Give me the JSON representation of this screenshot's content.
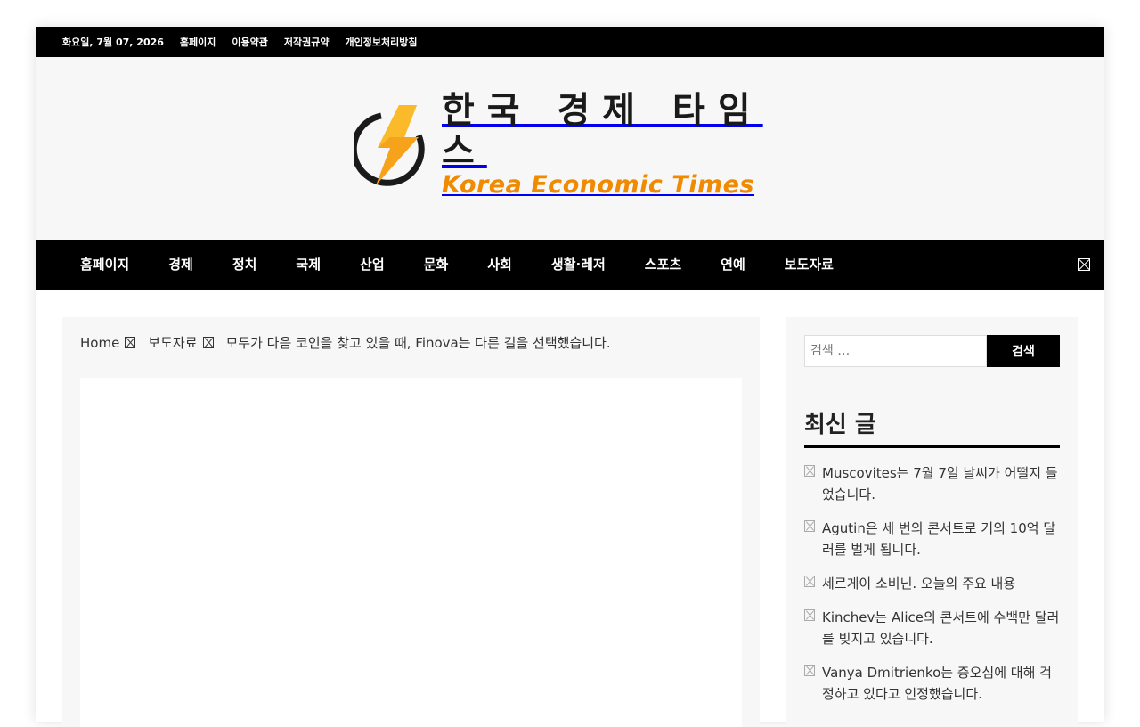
{
  "topbar": {
    "date": "화요일, 7월 07, 2026",
    "links": [
      "홈페이지",
      "이용약관",
      "저작권규약",
      "개인정보처리방침"
    ]
  },
  "logo": {
    "korean": "한국 경제 타임스",
    "english": "Korea Economic Times"
  },
  "nav": {
    "items": [
      "홈페이지",
      "경제",
      "정치",
      "국제",
      "산업",
      "문화",
      "사회",
      "생활·레저",
      "스포츠",
      "연예",
      "보도자료"
    ]
  },
  "breadcrumb": {
    "home": "Home",
    "category": "보도자료",
    "current": "모두가 다음 코인을 찾고 있을 때, Finova는 다른 길을 선택했습니다."
  },
  "sidebar": {
    "search_placeholder": "검색 …",
    "search_button": "검색",
    "recent_title": "최신 글",
    "recent_posts": [
      "Muscovites는 7월 7일 날씨가 어떨지 들었습니다.",
      "Agutin은 세 번의 콘서트로 거의 10억 달러를 벌게 됩니다.",
      "세르게이 소비닌. 오늘의 주요 내용",
      "Kinchev는 Alice의 콘서트에 수백만 달러를 빚지고 있습니다.",
      "Vanya Dmitrienko는 증오심에 대해 걱정하고 있다고 인정했습니다."
    ]
  },
  "colors": {
    "accent": "#f08a00",
    "bar": "#000000",
    "panel": "#f7f7f7"
  }
}
